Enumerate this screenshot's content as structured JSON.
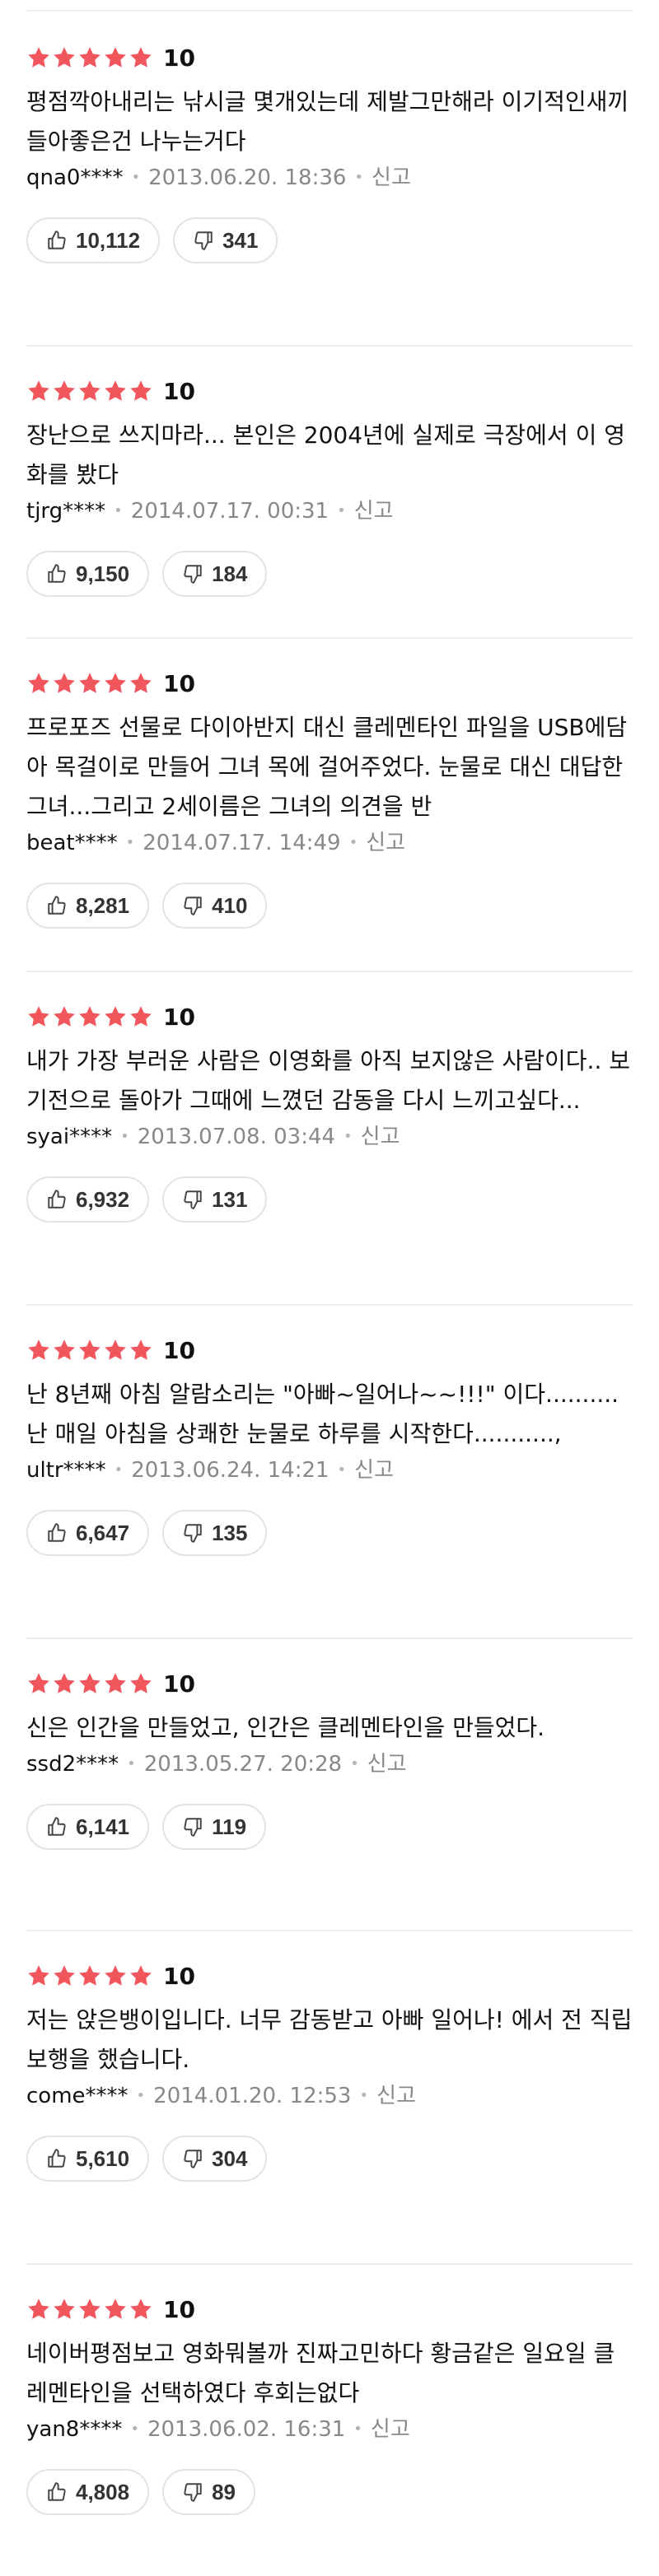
{
  "colors": {
    "star": "#f0565c",
    "divider": "#eeeeee",
    "meta_text": "#888888"
  },
  "icons": {
    "star": "star-icon",
    "like": "thumbs-up-icon",
    "dislike": "thumbs-down-icon"
  },
  "reviews": [
    {
      "stars": 5,
      "score": "10",
      "text": "평점깍아내리는 낚시글 몇개있는데 제발그만해라 이기적인새끼들아좋은건 나누는거다",
      "user": "qna0****",
      "date": "2013.06.20. 18:36",
      "report": "신고",
      "likes": "10,112",
      "dislikes": "341"
    },
    {
      "stars": 5,
      "score": "10",
      "text": "장난으로 쓰지마라... 본인은 2004년에 실제로 극장에서 이 영화를 봤다",
      "user": "tjrg****",
      "date": "2014.07.17. 00:31",
      "report": "신고",
      "likes": "9,150",
      "dislikes": "184"
    },
    {
      "stars": 5,
      "score": "10",
      "text": "프로포즈 선물로 다이아반지 대신 클레멘타인 파일을 USB에담아 목걸이로 만들어 그녀 목에 걸어주었다. 눈물로 대신 대답한 그녀...그리고 2세이름은 그녀의 의견을 반",
      "user": "beat****",
      "date": "2014.07.17. 14:49",
      "report": "신고",
      "likes": "8,281",
      "dislikes": "410"
    },
    {
      "stars": 5,
      "score": "10",
      "text": "내가 가장 부러운 사람은 이영화를 아직 보지않은 사람이다.. 보기전으로 돌아가 그때에 느꼈던 감동을 다시 느끼고싶다...",
      "user": "syai****",
      "date": "2013.07.08. 03:44",
      "report": "신고",
      "likes": "6,932",
      "dislikes": "131"
    },
    {
      "stars": 5,
      "score": "10",
      "text": "난 8년째 아침 알람소리는 \"아빠~일어나~~!!!\" 이다..........난 매일 아침을 상쾌한 눈물로 하루를 시작한다...........,",
      "user": "ultr****",
      "date": "2013.06.24. 14:21",
      "report": "신고",
      "likes": "6,647",
      "dislikes": "135"
    },
    {
      "stars": 5,
      "score": "10",
      "text": "신은 인간을 만들었고, 인간은 클레멘타인을 만들었다.",
      "user": "ssd2****",
      "date": "2013.05.27. 20:28",
      "report": "신고",
      "likes": "6,141",
      "dislikes": "119"
    },
    {
      "stars": 5,
      "score": "10",
      "text": "저는 앉은뱅이입니다. 너무 감동받고 아빠 일어나! 에서 전 직립보행을 했습니다.",
      "user": "come****",
      "date": "2014.01.20. 12:53",
      "report": "신고",
      "likes": "5,610",
      "dislikes": "304"
    },
    {
      "stars": 5,
      "score": "10",
      "text": "네이버평점보고 영화뭐볼까 진짜고민하다 황금같은 일요일 클레멘타인을 선택하였다 후회는없다",
      "user": "yan8****",
      "date": "2013.06.02. 16:31",
      "report": "신고",
      "likes": "4,808",
      "dislikes": "89"
    }
  ]
}
